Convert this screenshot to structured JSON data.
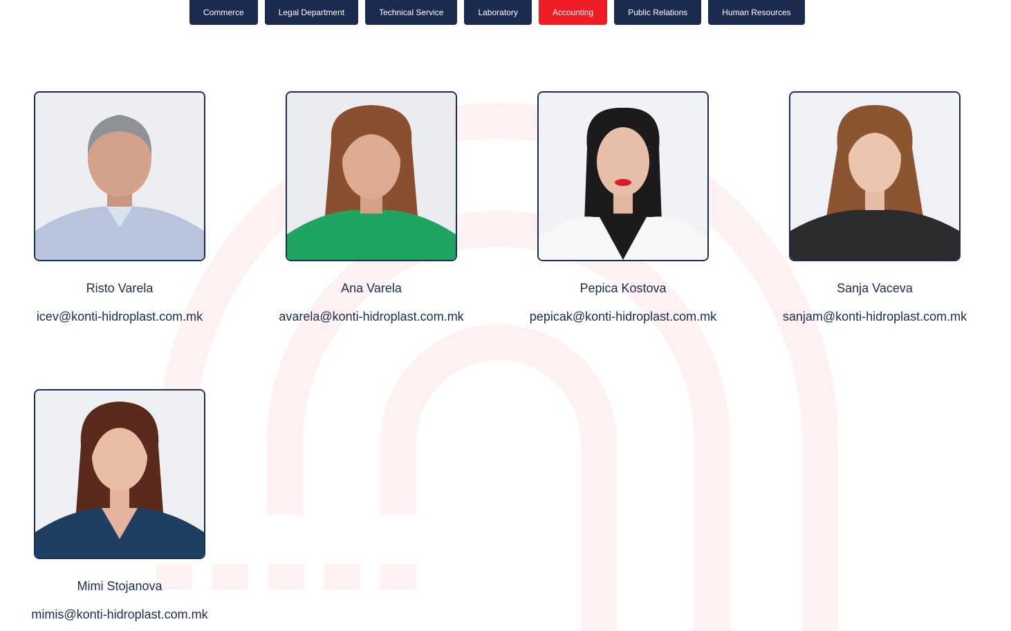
{
  "tabs": [
    {
      "label": "Commerce",
      "active": false
    },
    {
      "label": "Legal Department",
      "active": false
    },
    {
      "label": "Technical Service",
      "active": false
    },
    {
      "label": "Laboratory",
      "active": false
    },
    {
      "label": "Accounting",
      "active": true
    },
    {
      "label": "Public Relations",
      "active": false
    },
    {
      "label": "Human Resources",
      "active": false
    }
  ],
  "staff": [
    {
      "name": "Risto Varela",
      "email": "icev@konti-hidroplast.com.mk",
      "photo": "portrait-man-grey-hair"
    },
    {
      "name": "Ana Varela",
      "email": "avarela@konti-hidroplast.com.mk",
      "photo": "portrait-woman-green-top"
    },
    {
      "name": "Pepica Kostova",
      "email": "pepicak@konti-hidroplast.com.mk",
      "photo": "portrait-woman-white-blazer"
    },
    {
      "name": "Sanja Vaceva",
      "email": "sanjam@konti-hidroplast.com.mk",
      "photo": "portrait-woman-striped-top"
    },
    {
      "name": "Mimi Stojanova",
      "email": "mimis@konti-hidroplast.com.mk",
      "photo": "portrait-woman-navy-top"
    }
  ],
  "colors": {
    "navy": "#1c2a4f",
    "accent_red": "#ee1d25",
    "watermark": "#fdf1f1"
  }
}
